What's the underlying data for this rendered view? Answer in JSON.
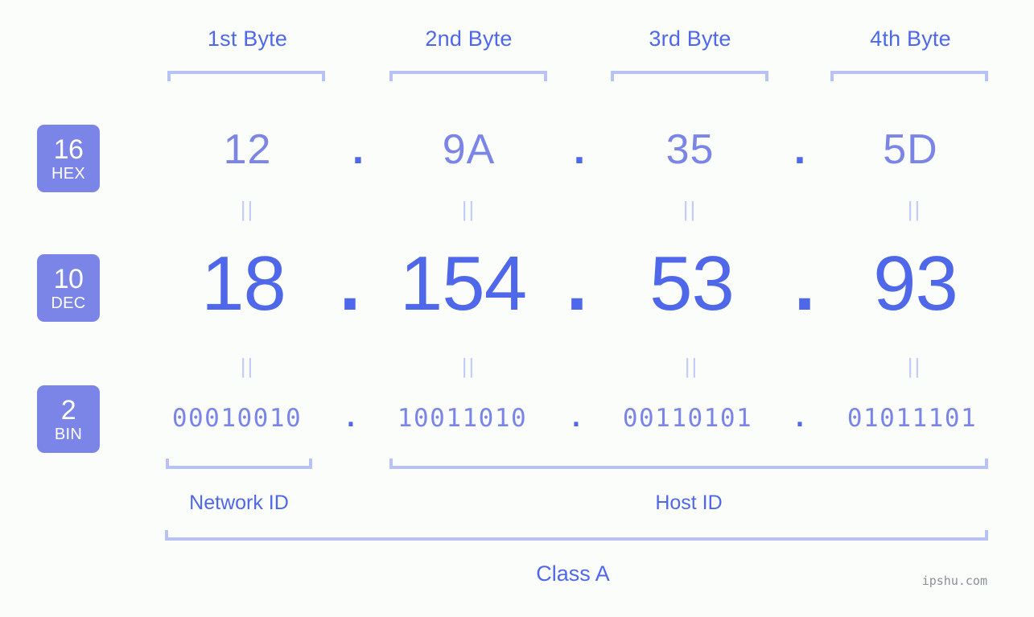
{
  "page": {
    "background_color": "#fafdfa",
    "accent_color": "#4f68ea",
    "accent_light_color": "#7b85e8",
    "bracket_color": "#b9c2f5",
    "watermark": "ipshu.com"
  },
  "byte_headers": [
    {
      "label": "1st Byte"
    },
    {
      "label": "2nd Byte"
    },
    {
      "label": "3rd Byte"
    },
    {
      "label": "4th Byte"
    }
  ],
  "bases": [
    {
      "number": "16",
      "name": "HEX"
    },
    {
      "number": "10",
      "name": "DEC"
    },
    {
      "number": "2",
      "name": "BIN"
    }
  ],
  "rows": {
    "hex": {
      "base_number": "16",
      "base_name": "HEX",
      "values": [
        "12",
        "9A",
        "35",
        "5D"
      ],
      "separators": [
        ".",
        ".",
        "."
      ]
    },
    "dec": {
      "base_number": "10",
      "base_name": "DEC",
      "values": [
        "18",
        "154",
        "53",
        "93"
      ],
      "separators": [
        ".",
        ".",
        "."
      ]
    },
    "bin": {
      "base_number": "2",
      "base_name": "BIN",
      "values": [
        "00010010",
        "10011010",
        "00110101",
        "01011101"
      ],
      "separators": [
        ".",
        ".",
        "."
      ]
    }
  },
  "equals_marks": {
    "glyph": "||",
    "hex_to_dec_count": 4,
    "dec_to_bin_count": 4
  },
  "sections": [
    {
      "label": "Network ID"
    },
    {
      "label": "Host ID"
    }
  ],
  "class": {
    "label": "Class A"
  }
}
